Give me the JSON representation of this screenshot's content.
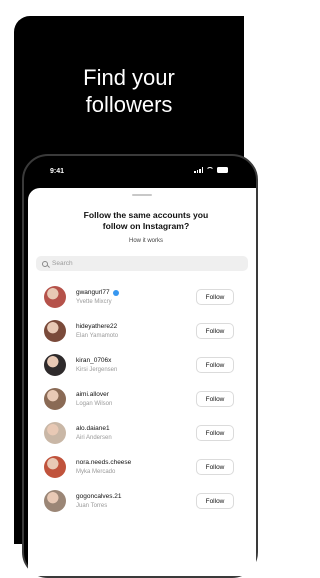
{
  "promo": {
    "headline_line1": "Find your",
    "headline_line2": "followers"
  },
  "status": {
    "time": "9:41"
  },
  "sheet": {
    "title_line1": "Follow the same accounts you",
    "title_line2": "follow on Instagram?",
    "how_it_works": "How it works",
    "search_placeholder": "Search"
  },
  "follow_label": "Follow",
  "accounts": [
    {
      "username": "gwangurl77",
      "name": "Yvette Mixcry",
      "verified": true,
      "avatar_color": "#b5524a"
    },
    {
      "username": "hideyathere22",
      "name": "Elan Yamamoto",
      "verified": false,
      "avatar_color": "#7a4a3a"
    },
    {
      "username": "kiran_0706x",
      "name": "Kirsi Jergensen",
      "verified": false,
      "avatar_color": "#2e2a2b"
    },
    {
      "username": "aimi.allover",
      "name": "Logan Wilson",
      "verified": false,
      "avatar_color": "#8a6a55"
    },
    {
      "username": "alo.daiane1",
      "name": "Airi Andersen",
      "verified": false,
      "avatar_color": "#c9b7a6"
    },
    {
      "username": "nora.needs.cheese",
      "name": "Myka Mercado",
      "verified": false,
      "avatar_color": "#c0533c"
    },
    {
      "username": "gogoncalves.21",
      "name": "Juan Torres",
      "verified": false,
      "avatar_color": "#9b8676"
    }
  ]
}
